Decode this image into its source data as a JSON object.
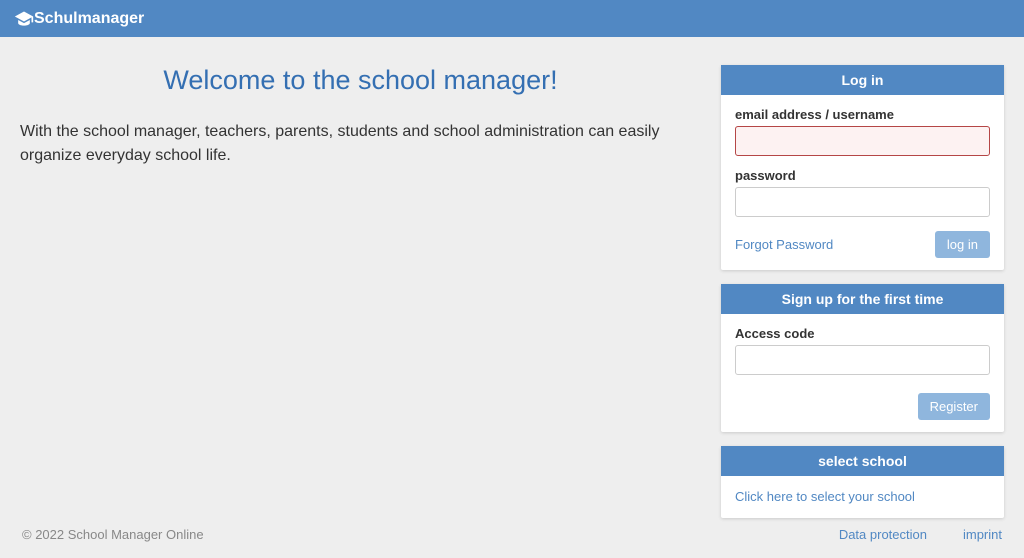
{
  "brand": "Schulmanager",
  "welcome": {
    "title": "Welcome to the school manager!",
    "description": "With the school manager, teachers, parents, students and school administration can easily organize everyday school life."
  },
  "login": {
    "title": "Log in",
    "email_label": "email address / username",
    "email_value": "",
    "password_label": "password",
    "password_value": "",
    "forgot": "Forgot Password",
    "button": "log in"
  },
  "signup": {
    "title": "Sign up for the first time",
    "access_label": "Access code",
    "access_value": "",
    "button": "Register"
  },
  "select_school": {
    "title": "select school",
    "link": "Click here to select your school"
  },
  "footer": {
    "copyright": "© 2022 School Manager Online",
    "privacy": "Data protection",
    "imprint": "imprint"
  }
}
